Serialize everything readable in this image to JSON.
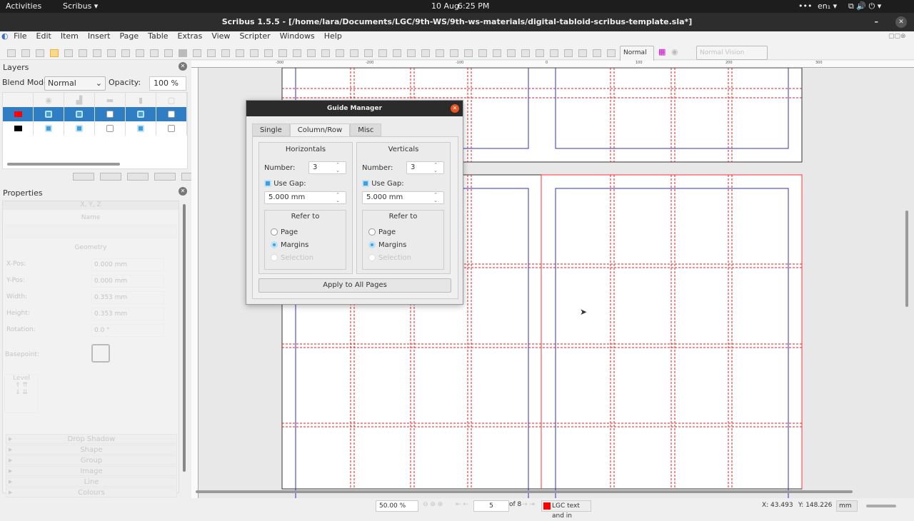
{
  "system": {
    "activities": "Activities",
    "app": "Scribus ▾",
    "date": "10 Aug",
    "time": "6:25 PM",
    "lang": "en₁ ▾"
  },
  "window": {
    "title": "Scribus 1.5.5 - [/home/lara/Documents/LGC/9th-WS/9th-ws-materials/digital-tabloid-scribus-template.sla*]"
  },
  "menu": [
    "File",
    "Edit",
    "Item",
    "Insert",
    "Page",
    "Table",
    "Extras",
    "View",
    "Scripter",
    "Windows",
    "Help"
  ],
  "toolbar": {
    "mode": "Normal",
    "vision": "Normal Vision"
  },
  "layers": {
    "title": "Layers",
    "blend_label": "Blend Mode:",
    "blend": "Normal",
    "opacity_label": "Opacity:",
    "opacity": "100 %",
    "rows": [
      {
        "color": "#ff0000",
        "selected": true,
        "checks": [
          true,
          true,
          false,
          true,
          false
        ]
      },
      {
        "color": "#000000",
        "selected": false,
        "checks": [
          true,
          true,
          false,
          true,
          false
        ]
      }
    ]
  },
  "properties": {
    "title": "Properties",
    "xyz": "X, Y, Z",
    "name": "Name",
    "geometry": "Geometry",
    "fields": [
      {
        "label": "X-Pos:",
        "value": "0.000 mm"
      },
      {
        "label": "Y-Pos:",
        "value": "0.000 mm"
      },
      {
        "label": "Width:",
        "value": "0.353 mm"
      },
      {
        "label": "Height:",
        "value": "0.353 mm"
      },
      {
        "label": "Rotation:",
        "value": "0.0 °"
      }
    ],
    "basepoint": "Basepoint:",
    "level": "Level",
    "sections": [
      "Drop Shadow",
      "Shape",
      "Group",
      "Image",
      "Line",
      "Colours"
    ]
  },
  "ruler": {
    "ticks": [
      "-300",
      "-200",
      "-100",
      "0",
      "100",
      "200",
      "300"
    ]
  },
  "dialog": {
    "title": "Guide Manager",
    "tabs": [
      "Single",
      "Column/Row",
      "Misc"
    ],
    "active_tab": "Column/Row",
    "horizontals": {
      "title": "Horizontals",
      "number_label": "Number:",
      "number": "3",
      "use_gap": "Use Gap:",
      "gap": "5.000 mm",
      "refer_to": "Refer to",
      "page": "Page",
      "margins": "Margins",
      "selection": "Selection"
    },
    "verticals": {
      "title": "Verticals",
      "number_label": "Number:",
      "number": "3",
      "use_gap": "Use Gap:",
      "gap": "5.000 mm",
      "refer_to": "Refer to",
      "page": "Page",
      "margins": "Margins",
      "selection": "Selection"
    },
    "apply": "Apply to All Pages"
  },
  "status": {
    "zoom": "50.00 %",
    "page": "5",
    "of": "of 8",
    "layer": "LGC text and in",
    "x": "X: 43.493",
    "y": "Y: 148.226",
    "unit": "mm"
  },
  "colors": {
    "accent": "#3fa0e0",
    "guide": "#e02020",
    "margin": "#3030c0"
  }
}
